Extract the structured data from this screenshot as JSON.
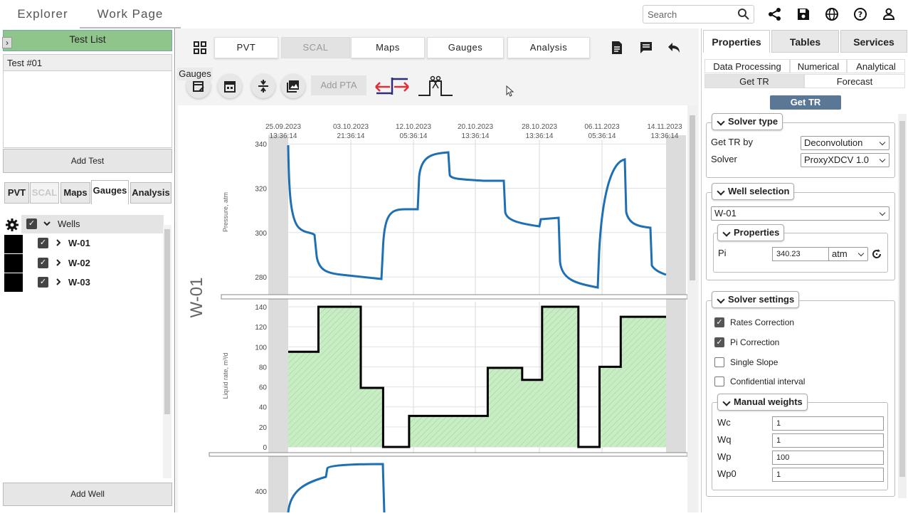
{
  "topnav": {
    "explorer": "Explorer",
    "workpage": "Work Page"
  },
  "search": {
    "placeholder": "Search"
  },
  "testlist": {
    "header": "Test List",
    "items": [
      "Test #01"
    ],
    "add_test": "Add Test"
  },
  "left_tabs": [
    "PVT",
    "SCAL",
    "Maps",
    "Gauges",
    "Analysis"
  ],
  "wells": {
    "header": "Wells",
    "items": [
      {
        "label": "W-01"
      },
      {
        "label": "W-02"
      },
      {
        "label": "W-03"
      }
    ],
    "add_well": "Add Well"
  },
  "center_tabs": [
    "PVT",
    "SCAL",
    "Maps",
    "Gauges",
    "Analysis"
  ],
  "toolbar": {
    "tooltip": "Gauges",
    "add_pta": "Add PTA"
  },
  "right_tabs": [
    "Properties",
    "Tables",
    "Services"
  ],
  "sub_tabs": [
    "Data Processing",
    "Numerical",
    "Analytical",
    "Get TR",
    "Forecast"
  ],
  "get_tr_button": "Get TR",
  "solver_type": {
    "title": "Solver type",
    "get_tr_by_label": "Get TR by",
    "get_tr_by_value": "Deconvolution",
    "solver_label": "Solver",
    "solver_value": "ProxyXDCV 1.0"
  },
  "well_selection": {
    "title": "Well selection",
    "well": "W-01",
    "properties_title": "Properties",
    "pi_label": "Pi",
    "pi_value": "340.23",
    "pi_unit": "atm"
  },
  "solver_settings": {
    "title": "Solver settings",
    "options": [
      {
        "label": "Rates Correction",
        "checked": true
      },
      {
        "label": "Pi Correction",
        "checked": true
      },
      {
        "label": "Single Slope",
        "checked": false
      },
      {
        "label": "Confidential interval",
        "checked": false
      }
    ]
  },
  "manual_weights": {
    "title": "Manual weights",
    "items": [
      {
        "label": "Wc",
        "value": "1"
      },
      {
        "label": "Wq",
        "value": "1"
      },
      {
        "label": "Wp",
        "value": "100"
      },
      {
        "label": "Wp0",
        "value": "1"
      }
    ]
  },
  "chart_data": {
    "type": "line",
    "well_label": "W-01",
    "time_ticks": [
      "25.09.2023 13:36:14",
      "03.10.2023 21:36:14",
      "12.10.2023 05:36:14",
      "20.10.2023 13:36:14",
      "28.10.2023 13:36:14",
      "06.11.2023 05:36:14",
      "14.11.2023 13:36:14"
    ],
    "pressure": {
      "ylabel": "Pressure, atm",
      "yticks": [
        340,
        320,
        300,
        280
      ],
      "ylim": [
        272,
        342
      ],
      "color": "#1f6fb5"
    },
    "rate": {
      "ylabel": "Liquid rate, m³/d",
      "yticks": [
        140,
        120,
        100,
        80,
        60,
        40,
        20,
        0
      ],
      "ylim": [
        0,
        145
      ],
      "color": "#000000",
      "fill": "#c8ecc4",
      "x": [
        0,
        5,
        5,
        12,
        12,
        15.7,
        15.7,
        20,
        20,
        24.5,
        24.5,
        33,
        33,
        38.7,
        38.7,
        42,
        42,
        48,
        48,
        51.5,
        51.5,
        55,
        55,
        60,
        60,
        62.5,
        62.5
      ],
      "values": [
        95,
        95,
        140,
        140,
        59,
        59,
        0,
        0,
        31,
        31,
        31,
        31,
        79,
        79,
        67,
        67,
        140,
        140,
        0,
        0,
        80,
        80,
        130,
        130,
        130,
        130,
        130
      ]
    },
    "third": {
      "yticks": [
        400
      ]
    }
  }
}
